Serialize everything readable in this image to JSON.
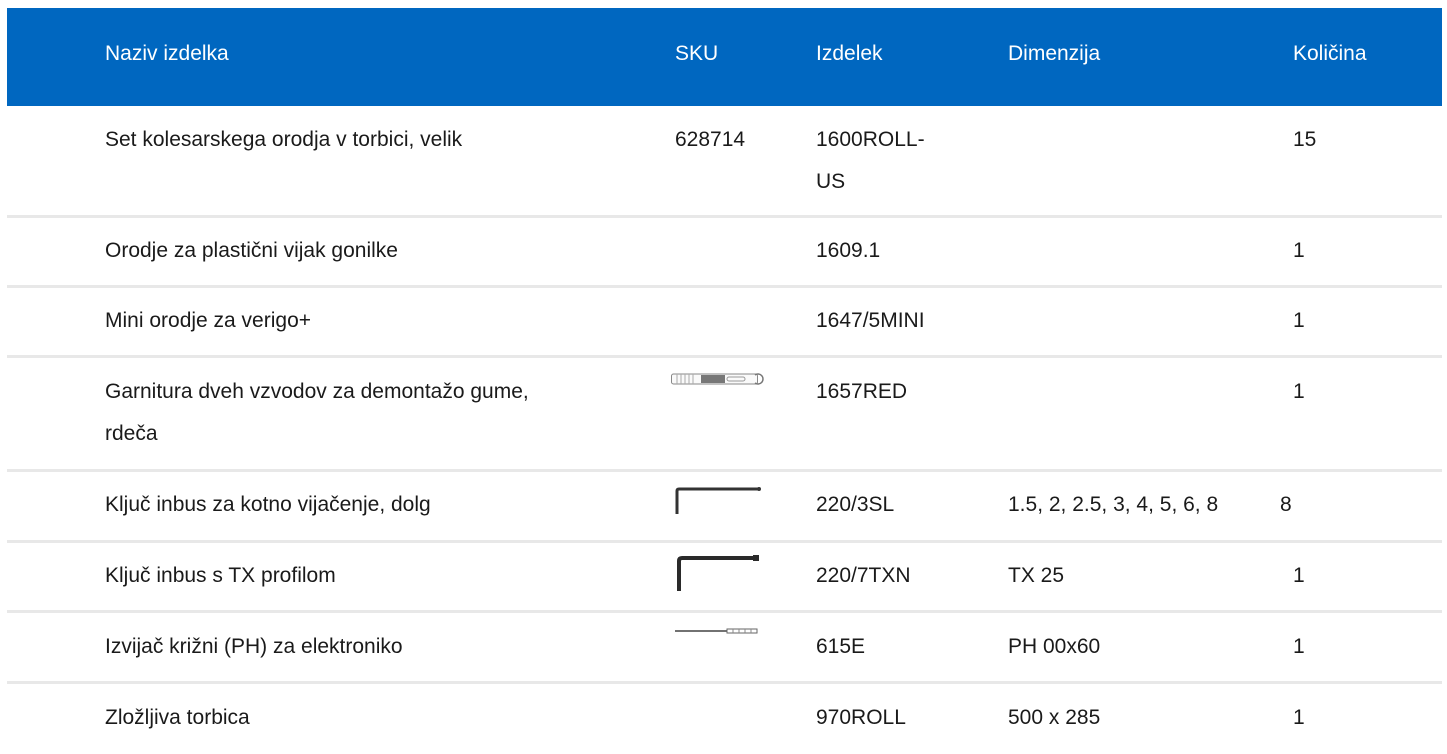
{
  "headers": {
    "name": "Naziv izdelka",
    "sku": "SKU",
    "product": "Izdelek",
    "dimension": "Dimenzija",
    "quantity": "Količina"
  },
  "rows": [
    {
      "name": "Set kolesarskega orodja v torbici, velik",
      "sku": "628714",
      "product_line1": "1600ROLL-",
      "product_line2": "US",
      "dimension": "",
      "quantity": "15"
    },
    {
      "name": "Orodje za plastični vijak gonilke",
      "sku": "",
      "product": "1609.1",
      "dimension": "",
      "quantity": "1"
    },
    {
      "name": "Mini orodje za verigo+",
      "sku": "",
      "product": "1647/5MINI",
      "dimension": "",
      "quantity": "1"
    },
    {
      "name_line1": "Garnitura dveh vzvodov za demontažo gume,",
      "name_line2": "rdeča",
      "sku_icon": "tire-lever-icon",
      "product": "1657RED",
      "dimension": "",
      "quantity": "1"
    },
    {
      "name": "Ključ inbus za kotno vijačenje, dolg",
      "sku_icon": "hex-key-icon",
      "product": "220/3SL",
      "dimension": "1.5, 2, 2.5, 3, 4, 5, 6, 8",
      "quantity": "8"
    },
    {
      "name": "Ključ inbus s TX profilom",
      "sku_icon": "torx-key-icon",
      "product": "220/7TXN",
      "dimension": "TX 25",
      "quantity": "1"
    },
    {
      "name": "Izvijač križni (PH) za elektroniko",
      "sku_icon": "screwdriver-icon",
      "product": "615E",
      "dimension": "PH 00x60",
      "quantity": "1"
    },
    {
      "name": "Zložljiva torbica",
      "sku": "",
      "product": "970ROLL",
      "dimension": "500 x 285",
      "quantity": "1"
    }
  ]
}
